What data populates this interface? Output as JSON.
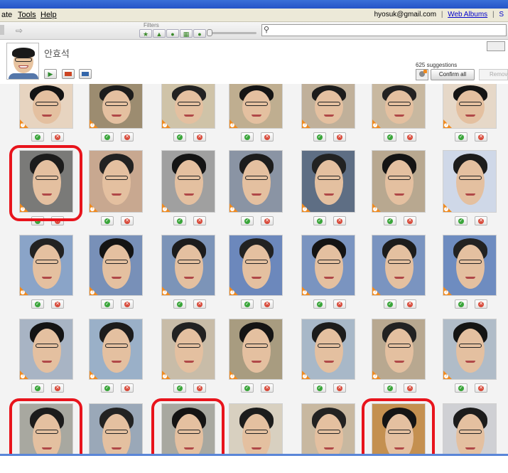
{
  "menubar": {
    "items": [
      "ate",
      "Tools",
      "Help"
    ],
    "account_email": "hyosuk@gmail.com",
    "separator": "|",
    "web_albums_link": "Web Albums",
    "trailing": "S"
  },
  "toolbar": {
    "filters_label": "Filters",
    "filter_icons": [
      "star-icon",
      "up-arrow-icon",
      "person-icon",
      "film-icon",
      "pin-icon"
    ],
    "filter_glyphs": [
      "★",
      "▲",
      "●",
      "▦",
      "●"
    ],
    "search_placeholder": ""
  },
  "person": {
    "name": "안효석",
    "suggestions_count_label": "625 suggestions",
    "confirm_all_label": "Confirm all",
    "remove_label": "Remove"
  },
  "header_buttons": [
    {
      "name": "play-slideshow-button",
      "glyph": "▶",
      "color": "#2e8b2e"
    },
    {
      "name": "blogger-button",
      "glyph": "▪",
      "color": "#cc4422"
    },
    {
      "name": "email-button",
      "glyph": "▪",
      "color": "#3366aa"
    }
  ],
  "grid": {
    "columns": 7,
    "confirm_glyph": "✓",
    "reject_glyph": "✕",
    "tile_note_glyph": "?",
    "highlighted_tiles": [
      [
        1,
        0
      ],
      [
        4,
        0
      ],
      [
        4,
        2
      ],
      [
        4,
        5
      ]
    ],
    "photos": [
      [
        "#e7d4c0",
        "#9c8c70",
        "#cfc3a8",
        "#bfae90",
        "#c0b09a",
        "#c8b8a0",
        "#e6d8c8"
      ],
      [
        "#7a7a78",
        "#c8a890",
        "#a0a0a0",
        "#8a94a4",
        "#5e6e84",
        "#b8a890",
        "#cfd8e8"
      ],
      [
        "#8aa4c8",
        "#7890b8",
        "#7c94b8",
        "#6c88bc",
        "#7a94c0",
        "#7a94c0",
        "#6e8cc0"
      ],
      [
        "#a8b4c4",
        "#9ab0c8",
        "#c8bca8",
        "#a89c80",
        "#a8b8c8",
        "#b8a890",
        "#b0bcc8"
      ],
      [
        "#a8a8a0",
        "#9aa8b8",
        "#a8a8a0",
        "#d8d0c0",
        "#c8b8a0",
        "#c49050",
        "#cfd0d4"
      ]
    ]
  }
}
